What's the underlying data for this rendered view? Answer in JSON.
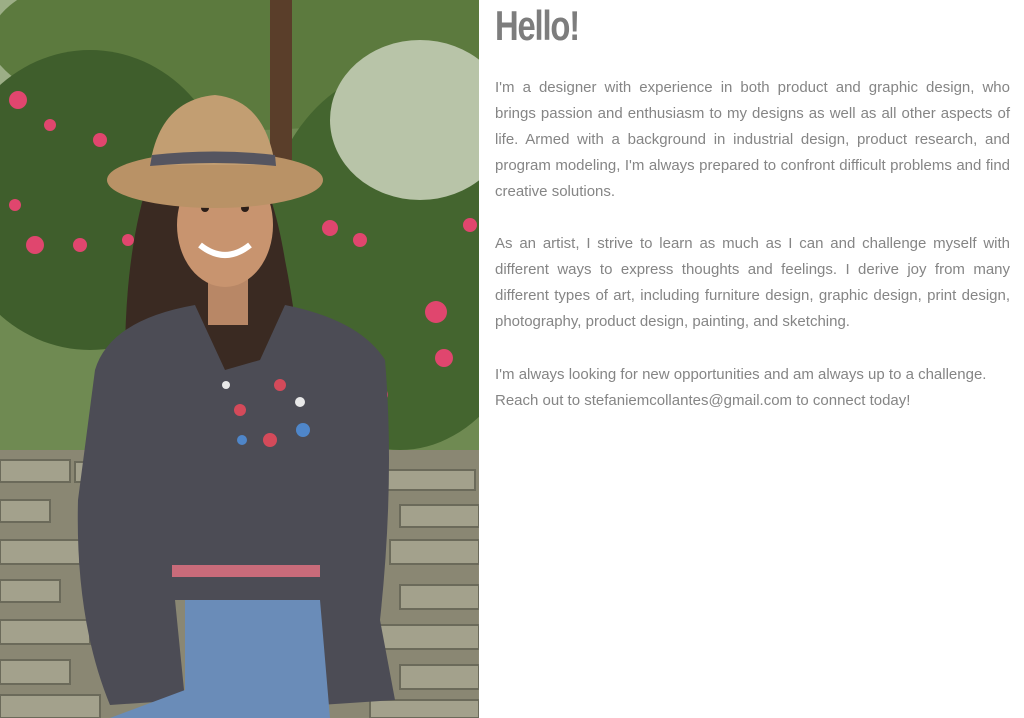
{
  "about": {
    "heading": "Hello!",
    "paragraphs": [
      "I'm a designer with experience in both product and graphic design, who brings passion and enthusiasm to my designs as well as all other aspects of life. Armed with a background in industrial design, product research, and program modeling, I'm always prepared to confront difficult problems and find creative solutions.",
      "As an artist, I strive to learn as much as I can and challenge myself with different ways to express thoughts and feelings. I derive joy from many different types of art, including furniture design, graphic design, print design, photography, product design, painting, and sketching.",
      "I'm always looking for new opportunities and am always up to a challenge. Reach out to stefaniemcollantes@gmail.com to connect today!"
    ]
  },
  "portrait": {
    "subject": "portrait photo of woman in tan hat and embroidered dark blouse in front of pink rose bushes and a stone wall"
  },
  "colors": {
    "heading": "#7d7d7d",
    "body_text": "#858585",
    "background": "#ffffff"
  }
}
